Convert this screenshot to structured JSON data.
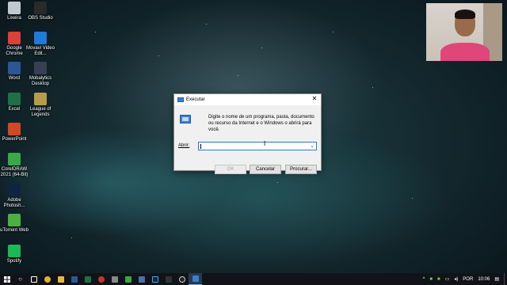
{
  "desktop": {
    "icons": [
      {
        "label": "Lixeira",
        "icon": "recycle-bin-icon",
        "color": "#c0c8d0"
      },
      {
        "label": "OBS Studio",
        "icon": "obs-icon",
        "color": "#2a2a2a"
      },
      {
        "label": "Google Chrome",
        "icon": "chrome-icon",
        "color": "#d9413a"
      },
      {
        "label": "Movavi Video Edit...",
        "icon": "movavi-icon",
        "color": "#1f7ad8"
      },
      {
        "label": "Word",
        "icon": "word-icon",
        "color": "#2b5797"
      },
      {
        "label": "Mobalytics Desktop",
        "icon": "mobalytics-icon",
        "color": "#3a3f55"
      },
      {
        "label": "Excel",
        "icon": "excel-icon",
        "color": "#1e7145"
      },
      {
        "label": "League of Legends",
        "icon": "league-icon",
        "color": "#b89b4a"
      },
      {
        "label": "PowerPoint",
        "icon": "powerpoint-icon",
        "color": "#d24726"
      },
      {
        "label": "CorelDRAW 2021 (64-Bit)",
        "icon": "coreldraw-icon",
        "color": "#3aa845"
      },
      {
        "label": "Adobe Photosh...",
        "icon": "photoshop-icon",
        "color": "#0f2440"
      },
      {
        "label": "uTorrent Web",
        "icon": "utorrent-icon",
        "color": "#4cb040"
      },
      {
        "label": "Spotify",
        "icon": "spotify-icon",
        "color": "#1db954"
      }
    ]
  },
  "run_dialog": {
    "title": "Executar",
    "close_glyph": "✕",
    "description": "Digite o nome de um programa, pasta, documento ou recurso da Internet e o Windows o abrirá para você.",
    "open_label": "Abrir:",
    "open_value": "",
    "ok_label": "OK",
    "cancel_label": "Cancelar",
    "browse_label": "Procurar..."
  },
  "taskbar": {
    "language": "POR",
    "time": "10:06"
  }
}
